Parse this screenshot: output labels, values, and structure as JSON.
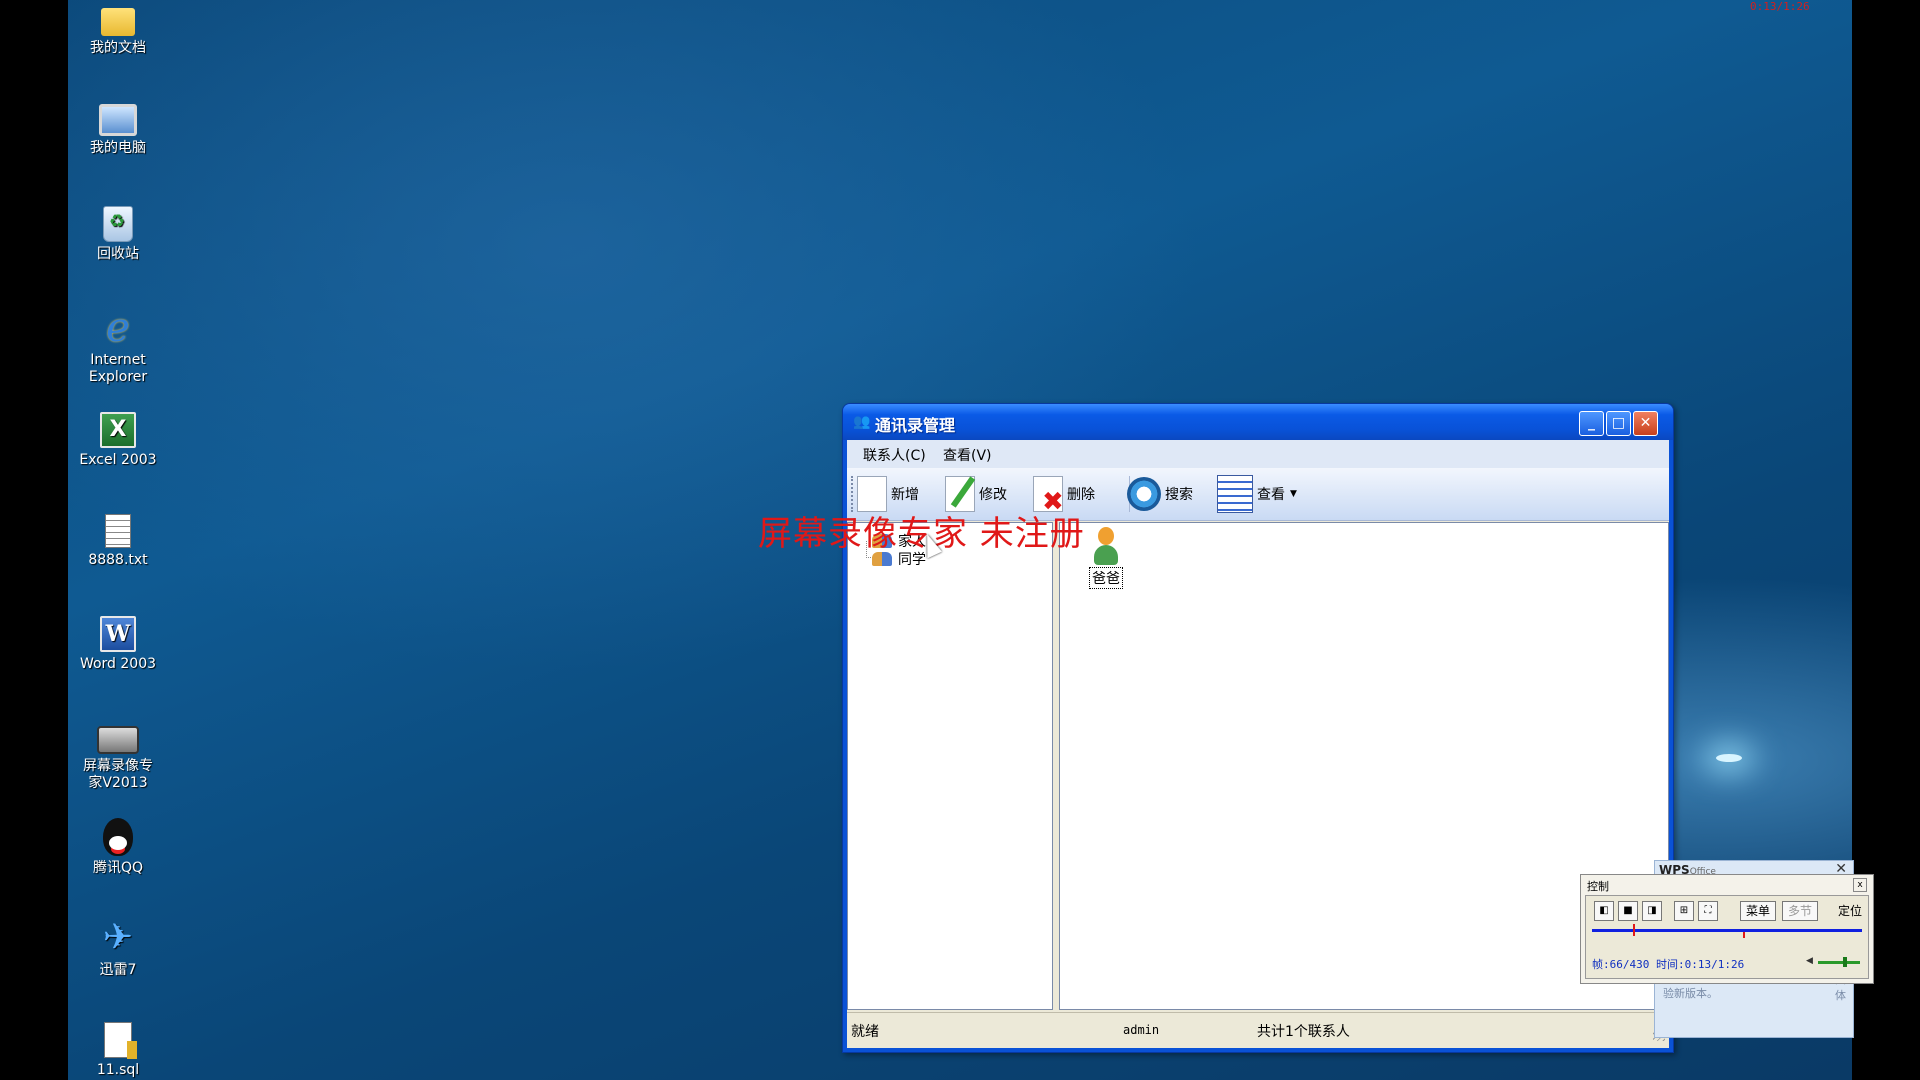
{
  "desktop": {
    "recording_timer": "0:13/1:26",
    "icons": [
      {
        "label": "我的文档",
        "icon": "my-documents-icon"
      },
      {
        "label": "我的电脑",
        "icon": "my-computer-icon"
      },
      {
        "label": "回收站",
        "icon": "recycle-bin-icon"
      },
      {
        "label": "Internet\nExplorer",
        "icon": "internet-explorer-icon"
      },
      {
        "label": "Excel 2003",
        "icon": "excel-icon"
      },
      {
        "label": "8888.txt",
        "icon": "text-file-icon"
      },
      {
        "label": "Word 2003",
        "icon": "word-icon"
      },
      {
        "label": "屏幕录像专\n家V2013",
        "icon": "screen-recorder-icon"
      },
      {
        "label": "腾讯QQ",
        "icon": "qq-icon"
      },
      {
        "label": "迅雷7",
        "icon": "xunlei-icon"
      },
      {
        "label": "11.sql",
        "icon": "sql-file-icon"
      }
    ]
  },
  "window": {
    "title": "通讯录管理",
    "title_icon": "contacts-app-icon",
    "controls": {
      "minimize": "_",
      "maximize": "□",
      "close": "✕"
    },
    "menu": {
      "contacts": "联系人(C)",
      "view": "查看(V)"
    },
    "toolbar": {
      "new": "新增",
      "edit": "修改",
      "delete": "删除",
      "search": "搜索",
      "view": "查看",
      "view_arrow": "▼"
    },
    "tree": {
      "groups": [
        "家人",
        "同学"
      ]
    },
    "list": {
      "contacts": [
        {
          "name": "爸爸",
          "icon": "contact-person-icon"
        }
      ]
    },
    "status": {
      "ready": "就绪",
      "user": "admin",
      "count": "共计1个联系人"
    }
  },
  "watermark": "屏幕录像专家 未注册",
  "wps_popup": {
    "logo": "WPS",
    "logo_sub": "Office",
    "close": "✕",
    "text": "验新版本。",
    "partial_text": "团体"
  },
  "control_panel": {
    "title": "控制",
    "close": "x",
    "buttons": {
      "menu": "菜单",
      "multi": "多节",
      "locate": "定位"
    },
    "info": "帧:66/430 时间:0:13/1:26",
    "progress": 0.15,
    "volume": 0.6
  },
  "colors": {
    "watermark": "#e01818",
    "titlebar": "#0a52d6",
    "desktop": "#0f5a92"
  }
}
